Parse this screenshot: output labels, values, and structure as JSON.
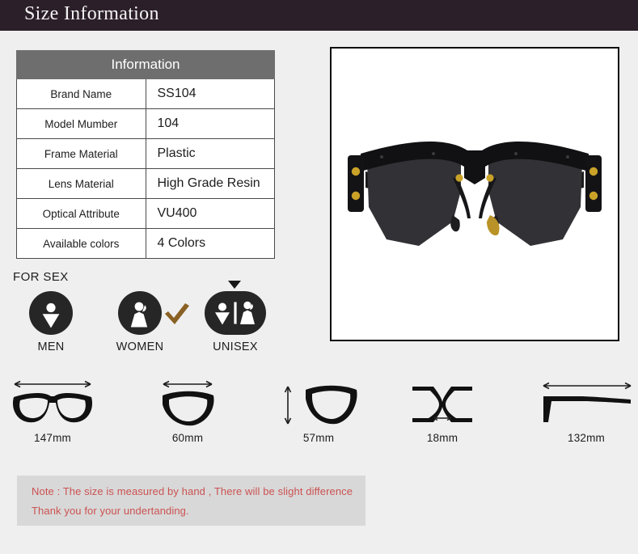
{
  "header": {
    "title": "Size Information"
  },
  "info_table": {
    "header_label": "Information",
    "rows": [
      {
        "key": "Brand Name",
        "value": "SS104"
      },
      {
        "key": "Model Mumber",
        "value": "104"
      },
      {
        "key": "Frame Material",
        "value": "Plastic"
      },
      {
        "key": "Lens Material",
        "value": "High Grade Resin"
      },
      {
        "key": "Optical Attribute",
        "value": "VU400"
      },
      {
        "key": "Available colors",
        "value": "4 Colors"
      }
    ]
  },
  "for_sex": {
    "label": "FOR SEX",
    "options": [
      {
        "caption": "MEN",
        "icon": "male-figure-icon",
        "selected": false
      },
      {
        "caption": "WOMEN",
        "icon": "female-figure-icon",
        "selected": false
      },
      {
        "caption": "UNISEX",
        "icon": "unisex-figures-icon",
        "selected": true
      }
    ],
    "check_icon": "check-mark-icon",
    "check_color": "#8a6124",
    "pointer_icon": "triangle-down-pointer-icon",
    "badge_color": "#262626"
  },
  "product_photo": {
    "icon": "sunglasses-product-photo",
    "frame_color": "#0d0d0d",
    "background": "#ffffff",
    "lens_color": "#323236",
    "frame_material_color": "#111114",
    "rivet_color": "#c9a227"
  },
  "measurements": [
    {
      "label": "147mm",
      "icon": "frame-total-width-icon"
    },
    {
      "label": "60mm",
      "icon": "lens-width-icon"
    },
    {
      "label": "57mm",
      "icon": "lens-height-icon"
    },
    {
      "label": "18mm",
      "icon": "bridge-width-icon"
    },
    {
      "label": "132mm",
      "icon": "temple-length-icon"
    }
  ],
  "note": {
    "lines": [
      "Note : The size is measured by hand , There will be slight difference",
      "Thank you for your undertanding."
    ],
    "text_color": "#cc5252",
    "background": "#d8d8d8"
  }
}
